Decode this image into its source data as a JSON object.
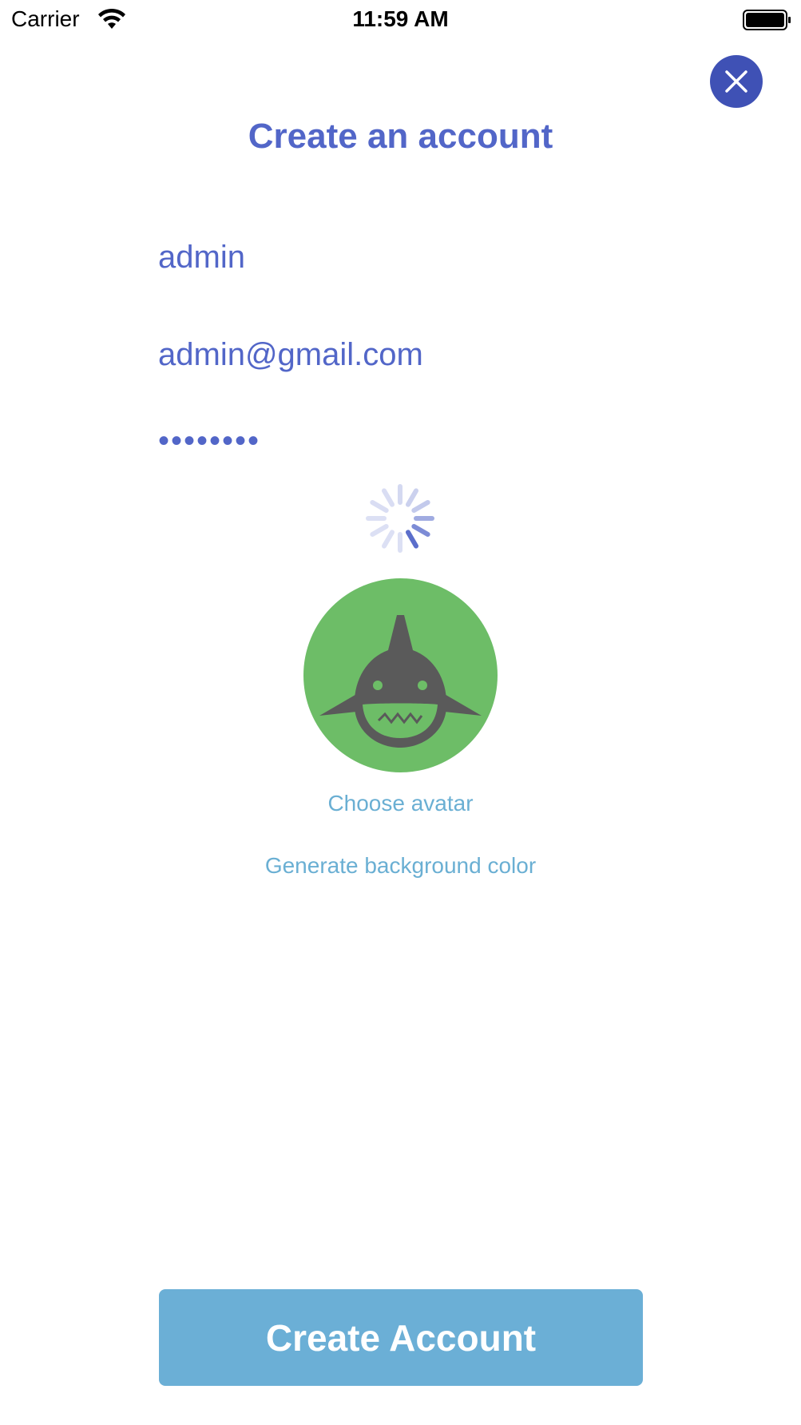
{
  "status_bar": {
    "carrier": "Carrier",
    "time": "11:59 AM",
    "wifi_icon": "wifi-icon",
    "battery_icon": "battery-icon"
  },
  "header": {
    "title": "Create an account",
    "close_icon": "close-icon"
  },
  "form": {
    "username_value": "admin",
    "email_value": "admin@gmail.com",
    "password_value": "••••••••"
  },
  "avatar": {
    "icon": "shark-icon",
    "background_color": "#6dbd67",
    "choose_label": "Choose avatar",
    "generate_color_label": "Generate background color"
  },
  "actions": {
    "create_label": "Create Account"
  },
  "colors": {
    "accent": "#5266c8",
    "close_button": "#3f51b5",
    "link": "#6aafd3",
    "primary_button": "#6bafd6"
  }
}
